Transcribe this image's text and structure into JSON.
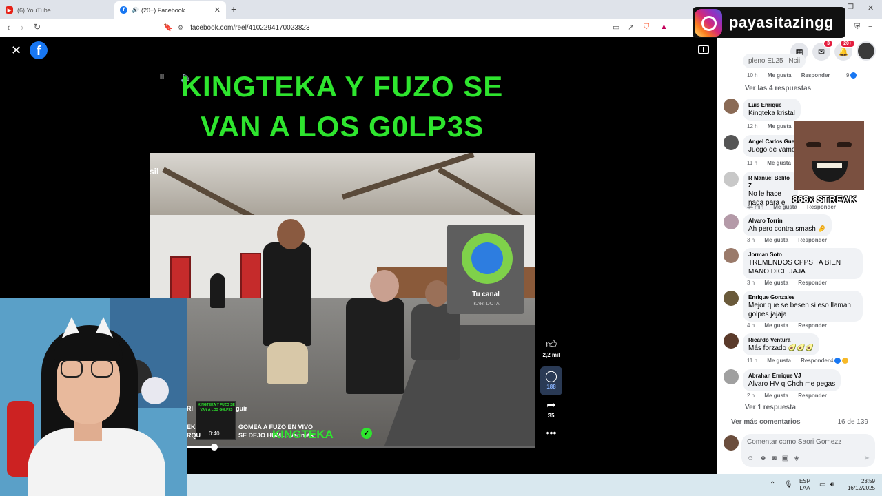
{
  "browser": {
    "tabs": [
      {
        "label": "(6) YouTube",
        "active": false
      },
      {
        "label": "(20+) Facebook",
        "active": true
      }
    ],
    "url": "facebook.com/reel/4102294170023823"
  },
  "reel": {
    "title_line1": "KINGTEKA Y FUZO SE",
    "title_line2": "VAN A LOS G0LP3S",
    "video_corner_label": "sil",
    "channel_card": {
      "label": "Tu canal",
      "sub": "IKARI DOTA"
    },
    "caption_line1": "GOMEA A FUZO EN VIVO",
    "caption_line2": "SE DEJO HUMI... Ver más",
    "caption_prefix1": "EK",
    "caption_prefix2": "RQU",
    "caption_author_fragment": "RI",
    "caption_seguir_fragment": "guir",
    "thumbnail_title": "KINGTEKA Y FUZO SE VAN A LOS G0LP3S",
    "thumbnail_time": "0:40",
    "name_overlay": "KINGTEKA",
    "progress": 0.08,
    "actions": {
      "likes": "2,2 mil",
      "comments": "188",
      "shares": "35"
    }
  },
  "comments_panel": {
    "top_badges": {
      "messenger": "3",
      "notifications": "20+"
    },
    "top_partial": {
      "text": "pleno EL25 i Ncii",
      "time": "10 h",
      "like": "Me gusta",
      "reply": "Responder",
      "reactions": "9"
    },
    "see_replies_4": "Ver las 4 respuestas",
    "comments": [
      {
        "name": "Luis Enrique",
        "text": "Kingteka kristal",
        "time": "12 h",
        "like": "Me gusta"
      },
      {
        "name": "Angel Carlos Gue",
        "text": "Juego de vamos",
        "time": "11 h",
        "like": "Me gusta"
      },
      {
        "name": "R Manuel Belito Z",
        "text": "No le hace nada para el",
        "time": "44 min",
        "like": "Me gusta",
        "reply": "Responder"
      },
      {
        "name": "Alvaro Torrin",
        "text": "Ah pero contra smash 🤌",
        "time": "3 h",
        "like": "Me gusta",
        "reply": "Responder"
      },
      {
        "name": "Jorman Soto",
        "text": "TREMENDOS CPPS TA BIEN MANO DICE JAJA",
        "time": "3 h",
        "like": "Me gusta",
        "reply": "Responder"
      },
      {
        "name": "Enrique Gonzales",
        "text": "Mejor que se besen si eso llaman golpes jajaja",
        "time": "4 h",
        "like": "Me gusta",
        "reply": "Responder"
      },
      {
        "name": "Ricardo Ventura",
        "text": "Más forzado 🥑🥑🥑",
        "time": "11 h",
        "like": "Me gusta",
        "reply": "Responder",
        "reactions": "4"
      },
      {
        "name": "Abrahan Enrique VJ",
        "text": "Alvaro HV q Chch me pegas",
        "time": "2 h",
        "like": "Me gusta",
        "reply": "Responder"
      }
    ],
    "see_replies_1": "Ver 1 respuesta",
    "more_comments": "Ver más comentarios",
    "count": "16 de 139",
    "composer_placeholder": "Comentar como Saori Gomezz"
  },
  "overlay": {
    "instagram_handle": "payasitazingg",
    "streak": "868x STREAK"
  },
  "taskbar": {
    "lang_line1": "ESP",
    "lang_line2": "LAA",
    "time": "23:59",
    "date": "16/12/2025"
  },
  "colors": {
    "title_green": "#2ee52e",
    "facebook_blue": "#1877f2",
    "badge_red": "#e41e3f"
  }
}
